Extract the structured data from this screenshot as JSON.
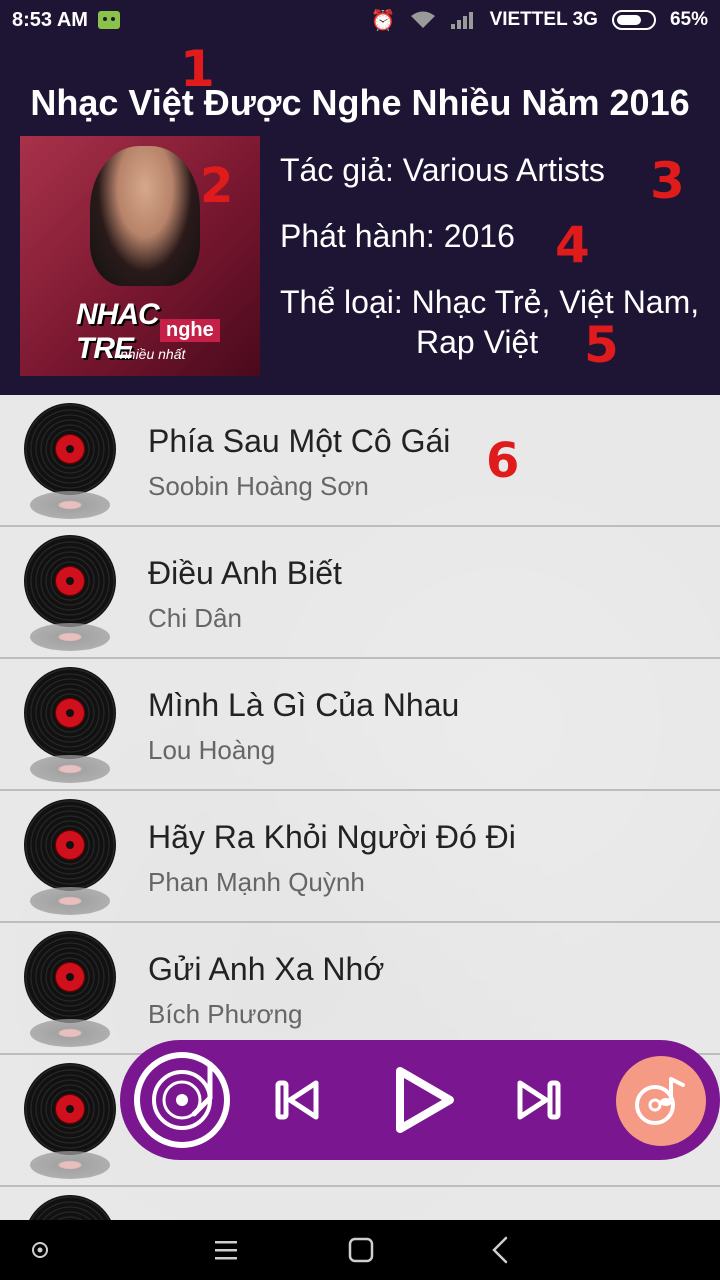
{
  "status_bar": {
    "time": "8:53 AM",
    "carrier": "VIETTEL 3G",
    "battery": "65%",
    "icons": [
      "android-icon",
      "alarm-icon",
      "wifi-icon",
      "signal-icon",
      "battery-icon"
    ]
  },
  "album": {
    "title": "Nhạc Việt Được Nghe Nhiều Năm 2016",
    "cover_text": [
      "NHAC",
      "TRE",
      "nghe",
      "nhiều nhất"
    ],
    "author_line": "Tác giả: Various Artists",
    "release_line": "Phát hành: 2016",
    "genre_line1": "Thể loại: Nhạc Trẻ, Việt Nam,",
    "genre_line2": "Rap Việt"
  },
  "markers": [
    "1",
    "2",
    "3",
    "4",
    "5",
    "6"
  ],
  "songs": [
    {
      "title": "Phía Sau Một Cô Gái",
      "artist": "Soobin Hoàng Sơn"
    },
    {
      "title": "Điều Anh Biết",
      "artist": "Chi Dân"
    },
    {
      "title": "Mình Là Gì Của Nhau",
      "artist": "Lou Hoàng"
    },
    {
      "title": "Hãy Ra Khỏi Người Đó Đi",
      "artist": "Phan Mạnh Quỳnh"
    },
    {
      "title": "Gửi Anh Xa Nhớ",
      "artist": "Bích Phương"
    },
    {
      "title": "",
      "artist": ""
    },
    {
      "title": "",
      "artist": ""
    }
  ],
  "player": {
    "buttons": [
      "turntable-icon",
      "previous-icon",
      "play-icon",
      "next-icon",
      "music-disc-icon"
    ]
  },
  "colors": {
    "header_bg": "#1e1535",
    "player_bg": "#7a168f",
    "marker": "#e01b1b",
    "music_button": "#f49a85"
  }
}
